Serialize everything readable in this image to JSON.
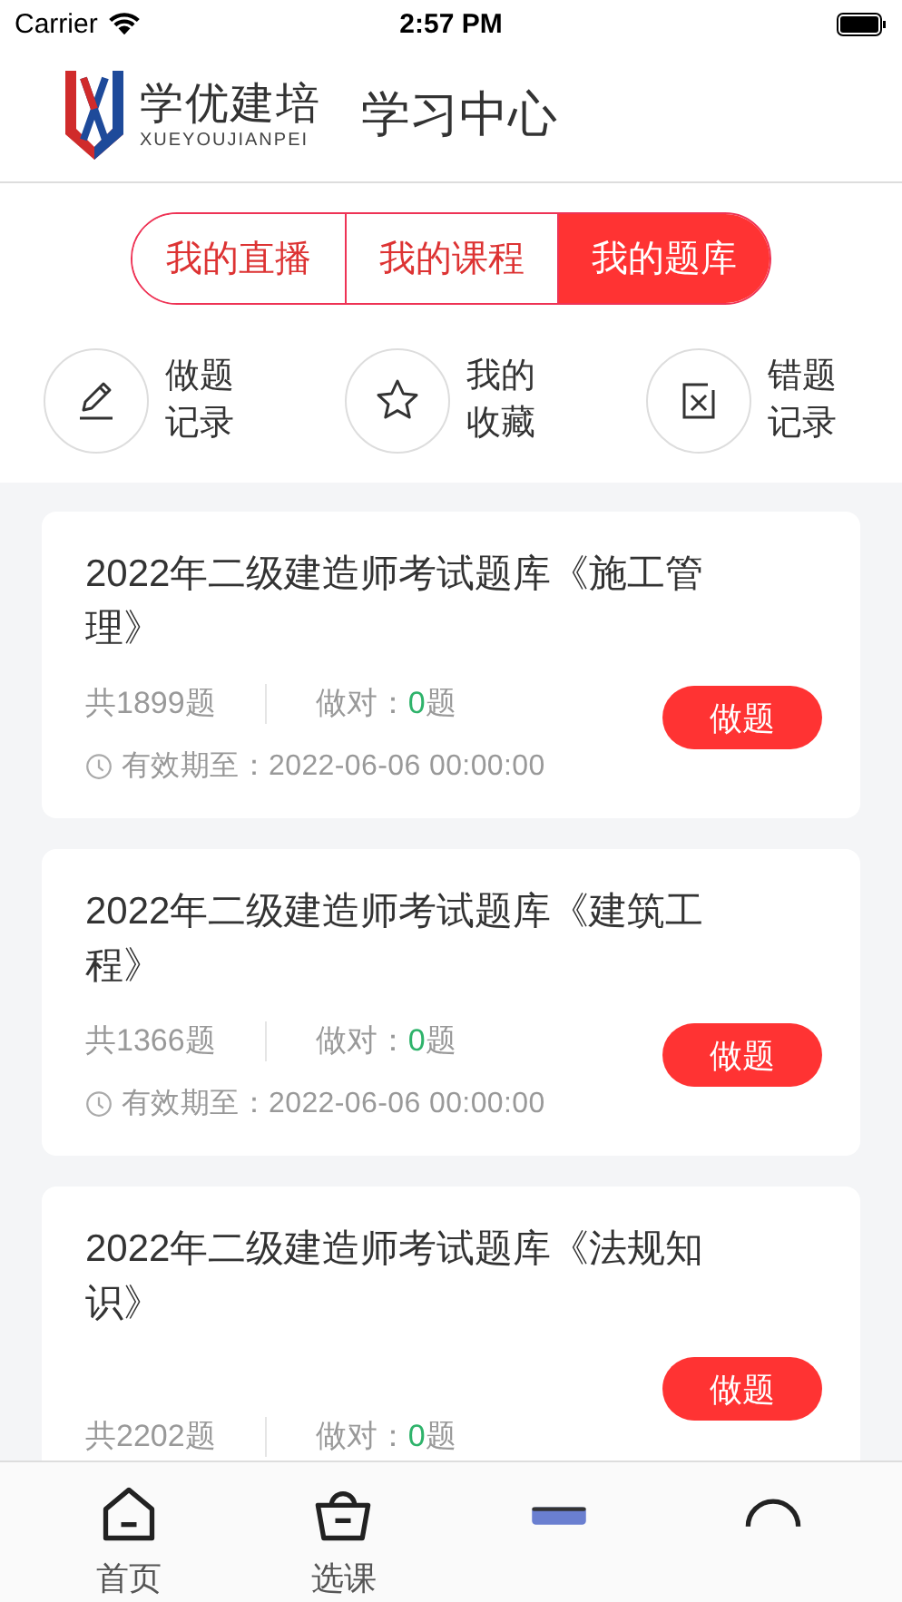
{
  "status_bar": {
    "carrier": "Carrier",
    "time": "2:57 PM"
  },
  "header": {
    "logo_name": "学优建培",
    "logo_pinyin": "XUEYOUJIANPEI",
    "title": "学习中心"
  },
  "tabs": [
    {
      "label": "我的直播",
      "selected": false
    },
    {
      "label": "我的课程",
      "selected": false
    },
    {
      "label": "我的题库",
      "selected": true
    }
  ],
  "shortcuts": [
    {
      "kind": "pencil",
      "label": "做题记录"
    },
    {
      "kind": "star",
      "label": "我的收藏"
    },
    {
      "kind": "wrong",
      "label": "错题记录"
    }
  ],
  "banks": [
    {
      "title": "2022年二级建造师考试题库《施工管理》",
      "total": "共1899题",
      "correct_label": "做对：",
      "correct_count": "0",
      "correct_unit": "题",
      "validity": "有效期至：2022-06-06 00:00:00",
      "button": "做题"
    },
    {
      "title": "2022年二级建造师考试题库《建筑工程》",
      "total": "共1366题",
      "correct_label": "做对：",
      "correct_count": "0",
      "correct_unit": "题",
      "validity": "有效期至：2022-06-06 00:00:00",
      "button": "做题"
    },
    {
      "title": "2022年二级建造师考试题库《法规知识》",
      "total": "共2202题",
      "correct_label": "做对：",
      "correct_count": "0",
      "correct_unit": "题",
      "button": "做题"
    }
  ],
  "nav": [
    {
      "kind": "home",
      "label": "首页"
    },
    {
      "kind": "basket",
      "label": "选课"
    },
    {
      "kind": "card"
    },
    {
      "kind": "person"
    }
  ]
}
